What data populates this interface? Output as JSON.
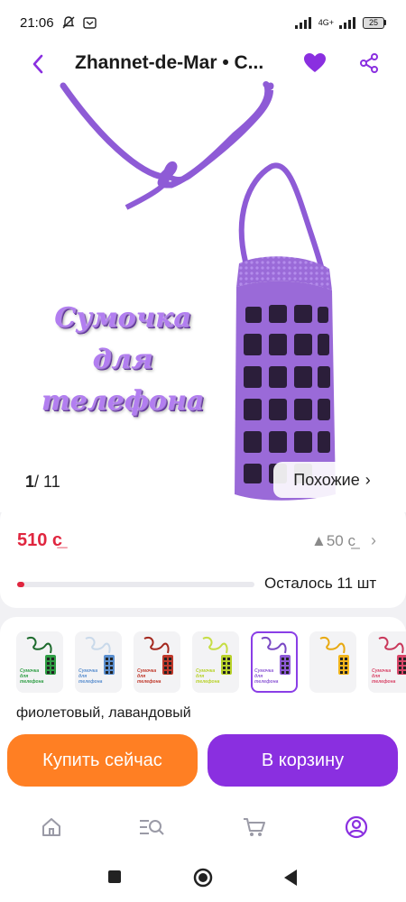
{
  "status": {
    "time": "21:06",
    "network": "4G+",
    "battery": "25"
  },
  "header": {
    "title": "Zhannet-de-Mar • С..."
  },
  "hero": {
    "caption_lines": [
      "Сумочка",
      "для",
      "телефона"
    ],
    "page_current": "1",
    "page_total": "/ 11",
    "similar_label": "Похожие",
    "similar_chevron": "›"
  },
  "price": {
    "value": "510 с̲",
    "old": "▲50 с̲",
    "chevron": "›",
    "stock_label": "Осталось 11 шт",
    "stock_fraction": 0.03
  },
  "variants": {
    "selected_label": "фиолетовый, лавандовый",
    "items": [
      {
        "color": "#2f9e45",
        "strap": "#1d6b2d",
        "caption": "Сумочка для телефона",
        "selected": false
      },
      {
        "color": "#5b8fcf",
        "strap": "#c9d9ea",
        "caption": "Сумочка для телефона",
        "selected": false
      },
      {
        "color": "#c0392b",
        "strap": "#a4281e",
        "caption": "Сумочка для телефона",
        "selected": false
      },
      {
        "color": "#b8d22a",
        "strap": "#c6dd44",
        "caption": "Сумочка для телефона",
        "selected": false
      },
      {
        "color": "#8e5bd6",
        "strap": "#7a48c4",
        "caption": "Сумочка для телефона",
        "selected": true
      },
      {
        "color": "#f2b51c",
        "strap": "#e8a910",
        "caption": "",
        "selected": false
      },
      {
        "color": "#d9476a",
        "strap": "#c9375a",
        "caption": "Сумочка для телефона",
        "selected": false
      }
    ]
  },
  "actions": {
    "buy_now": "Купить сейчас",
    "add_to_cart": "В корзину"
  },
  "nav_icons": [
    "home-icon",
    "catalog-search-icon",
    "cart-icon",
    "profile-icon"
  ],
  "colors": {
    "accent": "#8a2fe0",
    "orange": "#ff7f23",
    "price_red": "#e0263f"
  }
}
